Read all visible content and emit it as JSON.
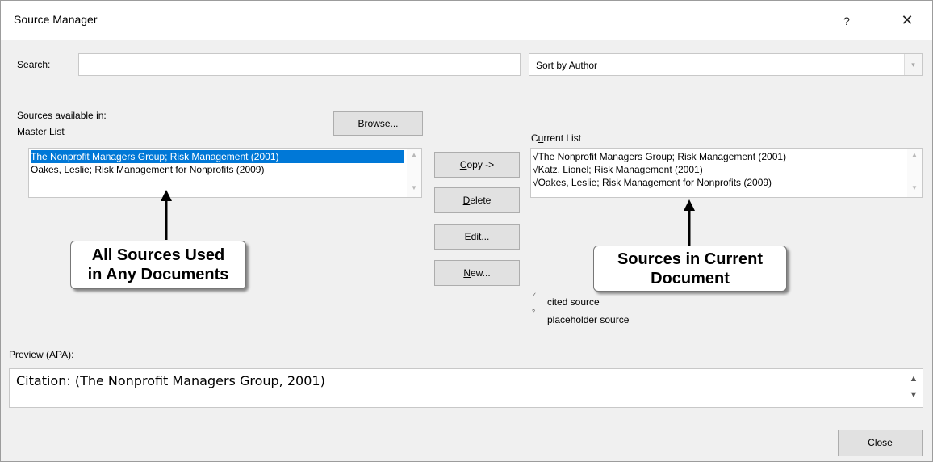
{
  "window": {
    "title": "Source Manager",
    "help_label": "?",
    "close_glyph": "✕"
  },
  "search": {
    "label_prefix": "",
    "label_accel": "S",
    "label_rest": "earch:",
    "value": ""
  },
  "sort": {
    "selected": "Sort by Author",
    "drop_glyph": "▾"
  },
  "master": {
    "available_prefix": "Sou",
    "available_accel": "r",
    "available_rest": "ces available in:",
    "list_title": "Master List",
    "browse_accel": "B",
    "browse_rest": "rowse...",
    "items": [
      "The Nonprofit Managers Group; Risk Management (2001)",
      "Oakes, Leslie; Risk Management for Nonprofits (2009)"
    ]
  },
  "actions": {
    "copy_accel": "C",
    "copy_rest": "opy ->",
    "delete_accel": "D",
    "delete_rest": "elete",
    "edit_accel": "E",
    "edit_rest": "dit...",
    "new_accel": "N",
    "new_rest": "ew..."
  },
  "current": {
    "title_prefix": "C",
    "title_accel": "u",
    "title_rest": "rrent List",
    "items": [
      "√The Nonprofit Managers Group; Risk Management (2001)",
      "√Katz, Lionel; Risk Management (2001)",
      "√Oakes, Leslie; Risk Management for Nonprofits (2009)"
    ],
    "legend_cited": "cited source",
    "legend_placeholder": "placeholder source",
    "legend_cited_mark": "✓",
    "legend_placeholder_mark": "?"
  },
  "callouts": {
    "left_line1": "All Sources Used",
    "left_line2": "in Any Documents",
    "right_line1": "Sources in Current",
    "right_line2": "Document"
  },
  "preview": {
    "label": "Preview (APA):",
    "text": "Citation:  (The Nonprofit Managers Group, 2001)"
  },
  "footer": {
    "close_label": "Close"
  },
  "icons": {
    "scroll_up": "▲",
    "scroll_down": "▼",
    "preview_up": "▲",
    "preview_down": "▼"
  }
}
